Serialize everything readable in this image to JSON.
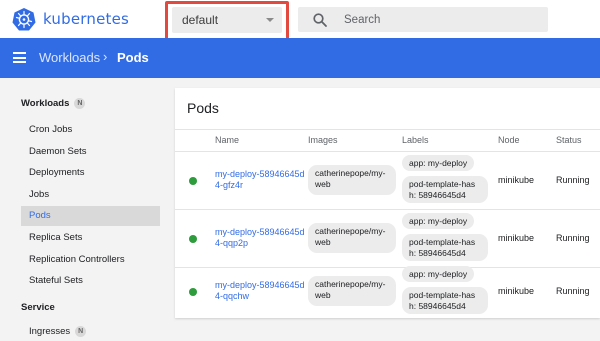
{
  "app": {
    "name": "kubernetes"
  },
  "namespace": {
    "selected": "default"
  },
  "search": {
    "placeholder": "Search"
  },
  "breadcrumb": {
    "parent": "Workloads",
    "separator": "›",
    "current": "Pods"
  },
  "sidebar": {
    "workloads": {
      "label": "Workloads",
      "badge": "N",
      "items": [
        {
          "label": "Cron Jobs"
        },
        {
          "label": "Daemon Sets"
        },
        {
          "label": "Deployments"
        },
        {
          "label": "Jobs"
        },
        {
          "label": "Pods",
          "active": true
        },
        {
          "label": "Replica Sets"
        },
        {
          "label": "Replication Controllers"
        },
        {
          "label": "Stateful Sets"
        }
      ]
    },
    "service": {
      "label": "Service",
      "items": [
        {
          "label": "Ingresses",
          "badge": "N"
        }
      ]
    }
  },
  "pods_card": {
    "title": "Pods",
    "columns": {
      "name": "Name",
      "images": "Images",
      "labels": "Labels",
      "node": "Node",
      "status": "Status"
    },
    "rows": [
      {
        "name": "my-deploy-58946645d4-gfz4r",
        "image": "catherinepope/my-web",
        "labels": [
          "app: my-deploy",
          "pod-template-hash: 58946645d4"
        ],
        "node": "minikube",
        "status": "Running"
      },
      {
        "name": "my-deploy-58946645d4-qqp2p",
        "image": "catherinepope/my-web",
        "labels": [
          "app: my-deploy",
          "pod-template-hash: 58946645d4"
        ],
        "node": "minikube",
        "status": "Running"
      },
      {
        "name": "my-deploy-58946645d4-qqchw",
        "image": "catherinepope/my-web",
        "labels": [
          "app: my-deploy",
          "pod-template-hash: 58946645d4"
        ],
        "node": "minikube",
        "status": "Running"
      }
    ]
  },
  "colors": {
    "brand": "#326ce5",
    "highlight": "#e2493f",
    "running": "#2e9b3c"
  }
}
